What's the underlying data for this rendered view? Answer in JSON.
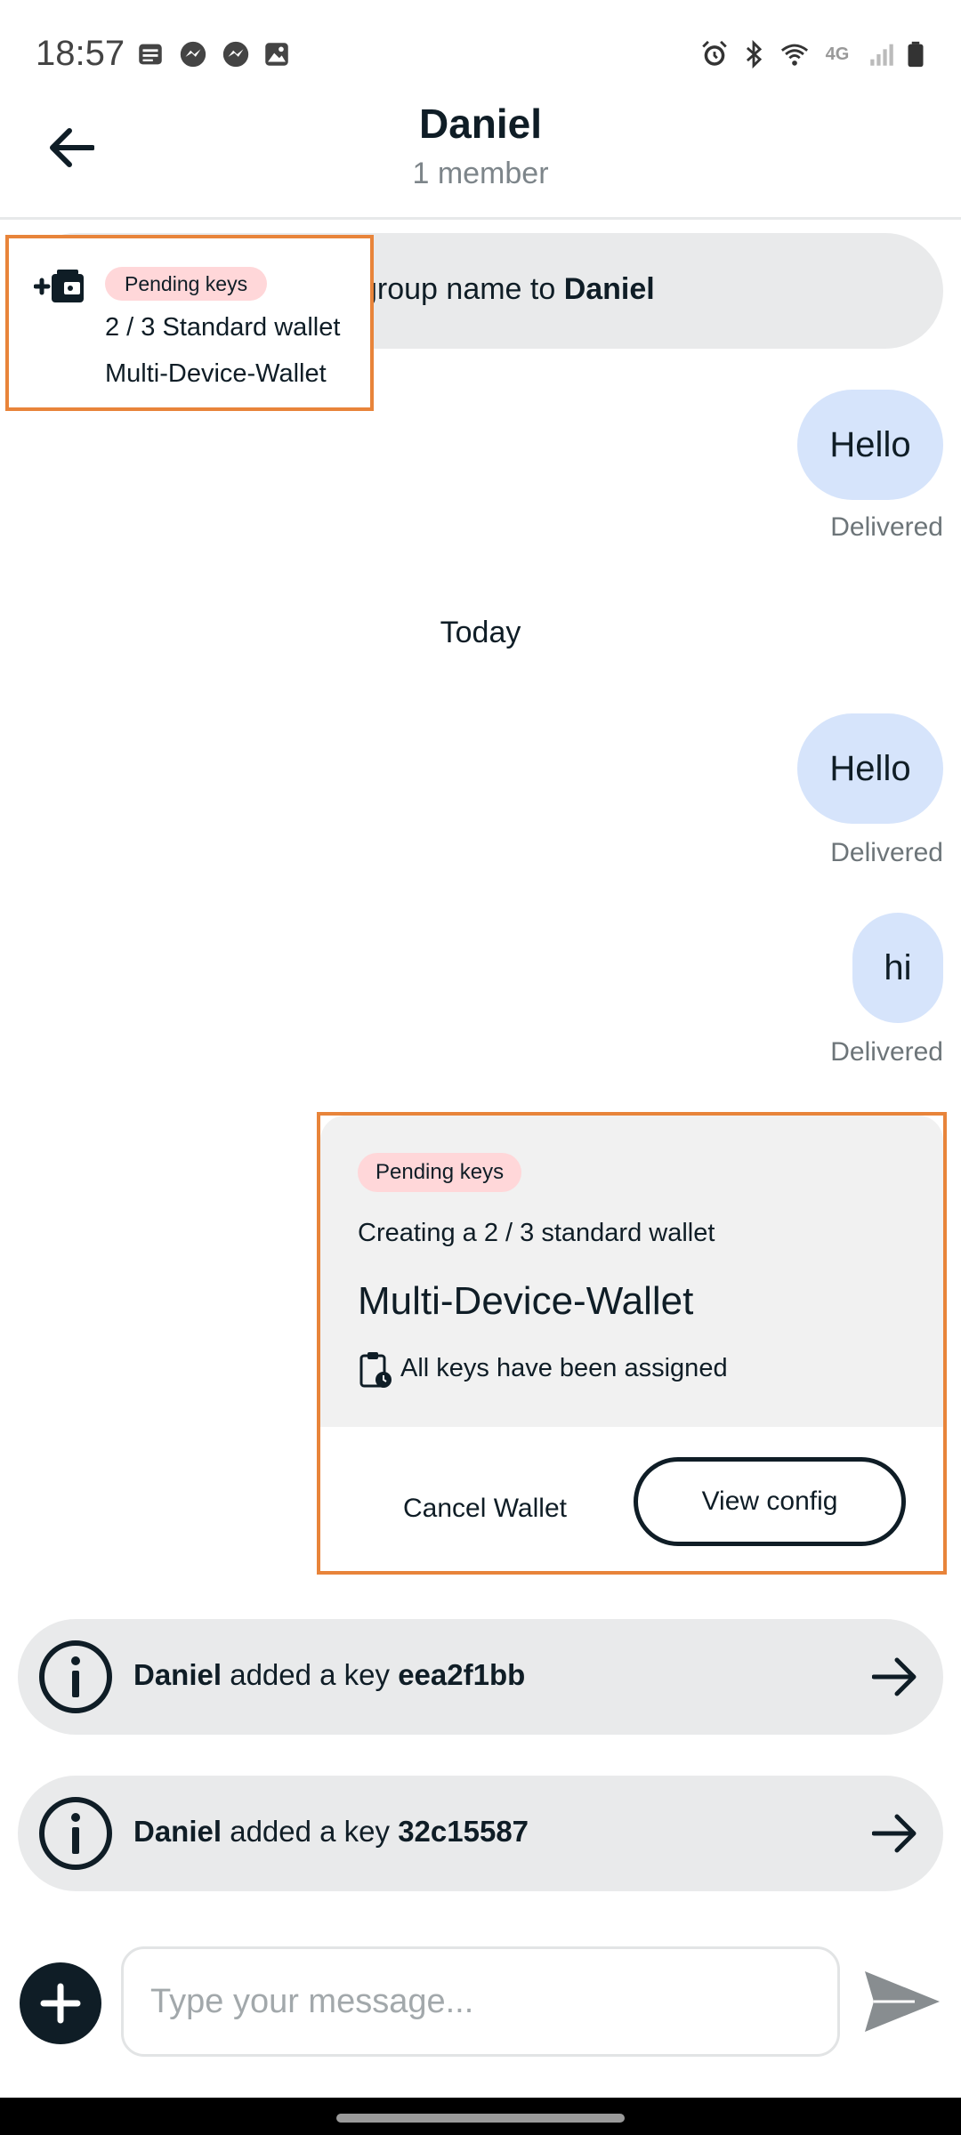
{
  "status_bar": {
    "time": "18:57",
    "left_icons": [
      "message-icon",
      "messenger-icon",
      "messenger-icon",
      "image-icon"
    ],
    "right_icons": [
      "alarm-icon",
      "bluetooth-icon",
      "wifi-icon",
      "4g-icon",
      "signal-icon",
      "battery-icon"
    ],
    "network": "4G"
  },
  "header": {
    "title": "Daniel",
    "subtitle": "1 member",
    "back_icon": "arrow-left-icon"
  },
  "system_message": {
    "prefix": "l group name to ",
    "name": "Daniel"
  },
  "messages": [
    {
      "text": "Hello",
      "status": "Delivered"
    },
    {
      "text": "Hello",
      "status": "Delivered"
    },
    {
      "text": "hi",
      "status": "Delivered"
    }
  ],
  "date_divider": "Today",
  "wallet_card": {
    "badge": "Pending keys",
    "creating": "Creating a 2 / 3 standard wallet",
    "wallet_name": "Multi-Device-Wallet",
    "assigned": "All keys have been assigned",
    "cancel_label": "Cancel Wallet",
    "view_label": "View config"
  },
  "notification": {
    "badge": "Pending keys",
    "line1": "2 / 3 Standard wallet",
    "line2": "Multi-Device-Wallet",
    "icon": "wallet-add-icon"
  },
  "key_events": [
    {
      "actor": "Daniel",
      "action": " added a key ",
      "key": "eea2f1bb"
    },
    {
      "actor": "Daniel",
      "action": " added a key ",
      "key": "32c15587"
    }
  ],
  "composer": {
    "placeholder": "Type your message...",
    "plus_icon": "plus-icon",
    "send_icon": "send-icon"
  },
  "colors": {
    "primary": "#0f1d26",
    "bubble": "#d6e4fb",
    "badge": "#ffd7d9",
    "pill": "#e9eaeb",
    "highlight": "#e8843a"
  }
}
